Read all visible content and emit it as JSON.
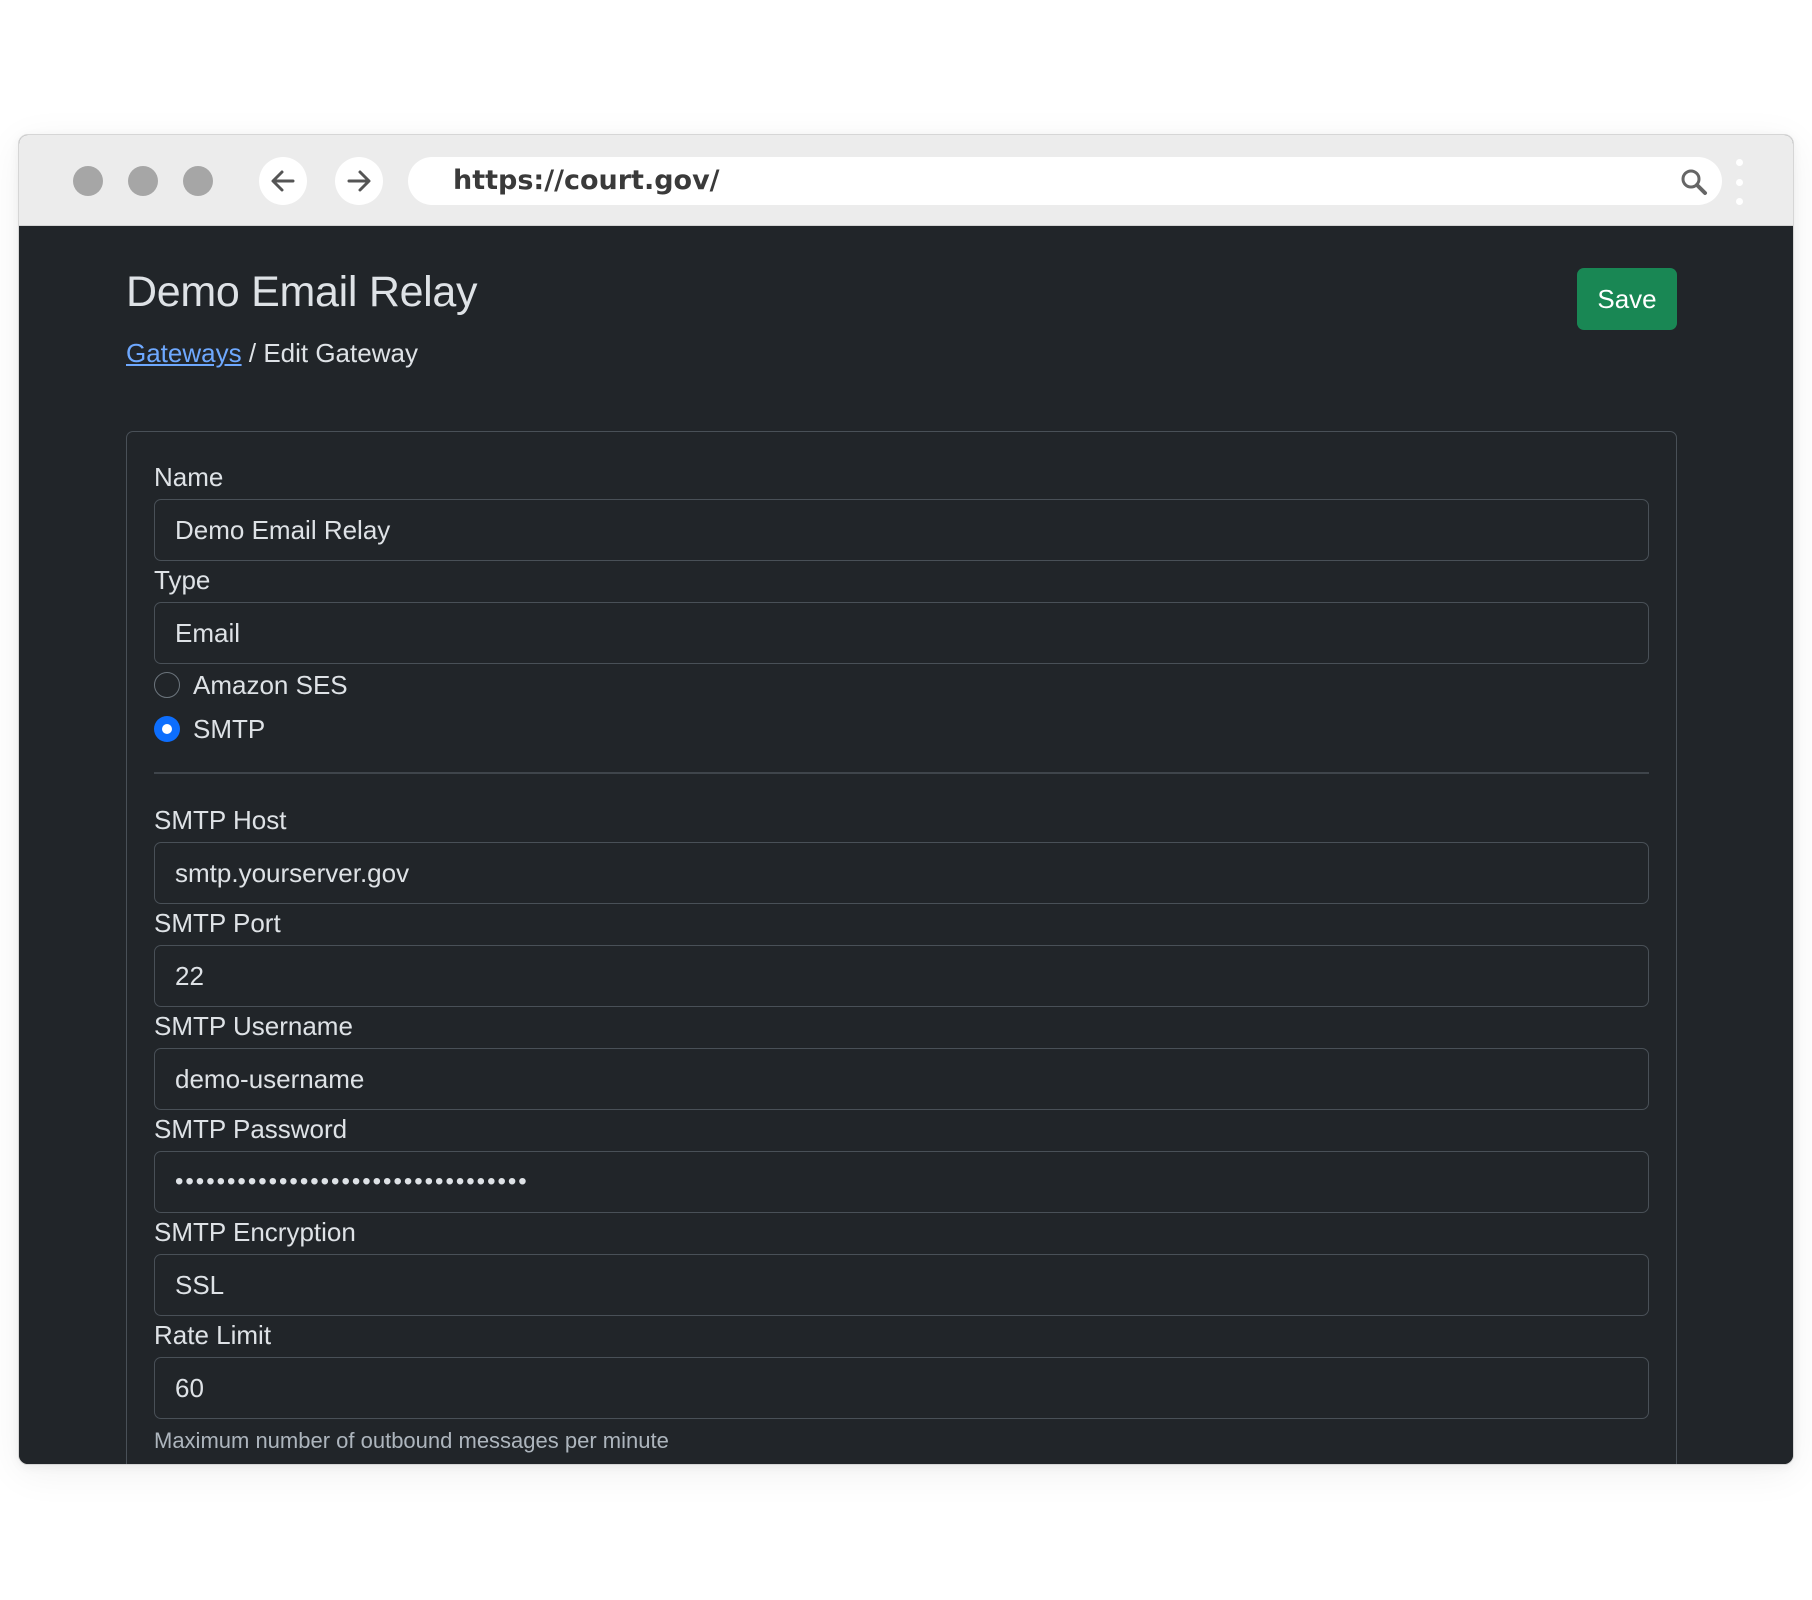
{
  "browser": {
    "url": "https://court.gov/"
  },
  "page": {
    "title": "Demo Email Relay",
    "breadcrumb": {
      "link": "Gateways",
      "separator": "/",
      "current": "Edit Gateway"
    },
    "save_label": "Save"
  },
  "form": {
    "name": {
      "label": "Name",
      "value": "Demo Email Relay"
    },
    "type": {
      "label": "Type",
      "value": "Email"
    },
    "provider_options": [
      {
        "label": "Amazon SES",
        "selected": false
      },
      {
        "label": "SMTP",
        "selected": true
      }
    ],
    "smtp_host": {
      "label": "SMTP Host",
      "value": "smtp.yourserver.gov"
    },
    "smtp_port": {
      "label": "SMTP Port",
      "value": "22"
    },
    "smtp_username": {
      "label": "SMTP Username",
      "value": "demo-username"
    },
    "smtp_password": {
      "label": "SMTP Password",
      "value": "••••••••••••••••••••••••••••••••••"
    },
    "smtp_encryption": {
      "label": "SMTP Encryption",
      "value": "SSL"
    },
    "rate_limit": {
      "label": "Rate Limit",
      "value": "60",
      "help": "Maximum number of outbound messages per minute"
    }
  },
  "colors": {
    "background": "#212529",
    "save_button": "#198754",
    "link": "#6ea8fe",
    "radio_selected": "#0d6efd"
  },
  "icons": {
    "back": "arrow-left-icon",
    "forward": "arrow-right-icon",
    "search": "search-icon",
    "menu": "kebab-menu-icon"
  }
}
